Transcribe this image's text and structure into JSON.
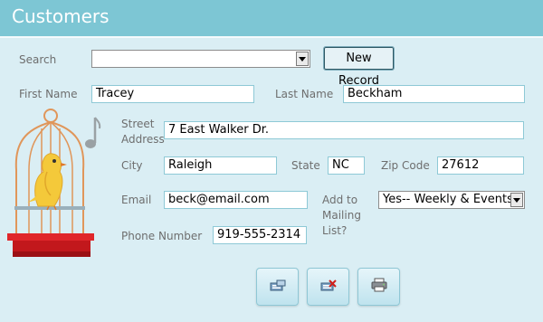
{
  "header": {
    "title": "Customers"
  },
  "search": {
    "label": "Search",
    "value": ""
  },
  "new_record_label": "New Record",
  "fields": {
    "first_name": {
      "label": "First Name",
      "value": "Tracey"
    },
    "last_name": {
      "label": "Last Name",
      "value": "Beckham"
    },
    "street": {
      "label": "Street Address",
      "value": "7 East Walker Dr."
    },
    "city": {
      "label": "City",
      "value": "Raleigh"
    },
    "state": {
      "label": "State",
      "value": "NC"
    },
    "zip": {
      "label": "Zip Code",
      "value": "27612"
    },
    "email": {
      "label": "Email",
      "value": "beck@email.com"
    },
    "mailing": {
      "label": "Add to Mailing List?",
      "value": "Yes-- Weekly & Events"
    },
    "phone": {
      "label": "Phone Number",
      "value": "919-555-2314"
    }
  },
  "icons": {
    "save": "save-record-icon",
    "delete": "delete-record-icon",
    "print": "print-icon",
    "illustration": "bird-in-cage-icon",
    "note": "music-note-icon"
  },
  "colors": {
    "header_bg": "#7dc6d4",
    "page_bg": "#daeef4",
    "field_border": "#8ec9d6"
  }
}
